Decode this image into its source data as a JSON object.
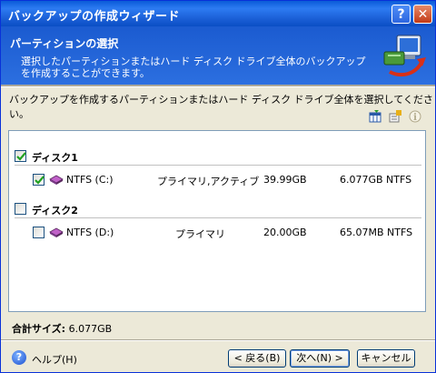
{
  "window": {
    "title": "バックアップの作成ウィザード"
  },
  "titlebar_buttons": {
    "help": "?",
    "close": "✕"
  },
  "header": {
    "title": "パーティションの選択",
    "description": "選択したパーティションまたはハード ディスク ドライブ全体のバックアップを作成することができます。"
  },
  "instruction": "バックアップを作成するパーティションまたはハード ディスク ドライブ全体を選択してください。",
  "toolbar": {
    "icons": [
      "columns-icon",
      "properties-icon",
      "info-icon"
    ]
  },
  "disks": [
    {
      "label": "ディスク1",
      "checked": true,
      "partitions": [
        {
          "name": "NTFS (C:)",
          "type": "プライマリ,アクティブ",
          "size": "39.99GB",
          "used": "6.077GB NTFS",
          "checked": true
        }
      ]
    },
    {
      "label": "ディスク2",
      "checked": false,
      "partitions": [
        {
          "name": "NTFS (D:)",
          "type": "プライマリ",
          "size": "20.00GB",
          "used": "65.07MB NTFS",
          "checked": false
        }
      ]
    }
  ],
  "total": {
    "label": "合計サイズ:",
    "value": "6.077GB"
  },
  "footer": {
    "help_label": "ヘルプ(H)",
    "back_label": "< 戻る(B)",
    "next_label": "次へ(N) >",
    "cancel_label": "キャンセル"
  },
  "colors": {
    "titlebar": "#0a5bd8",
    "header": "#1b5bd0",
    "dialog_bg": "#ece9d8",
    "check": "#21a121"
  }
}
